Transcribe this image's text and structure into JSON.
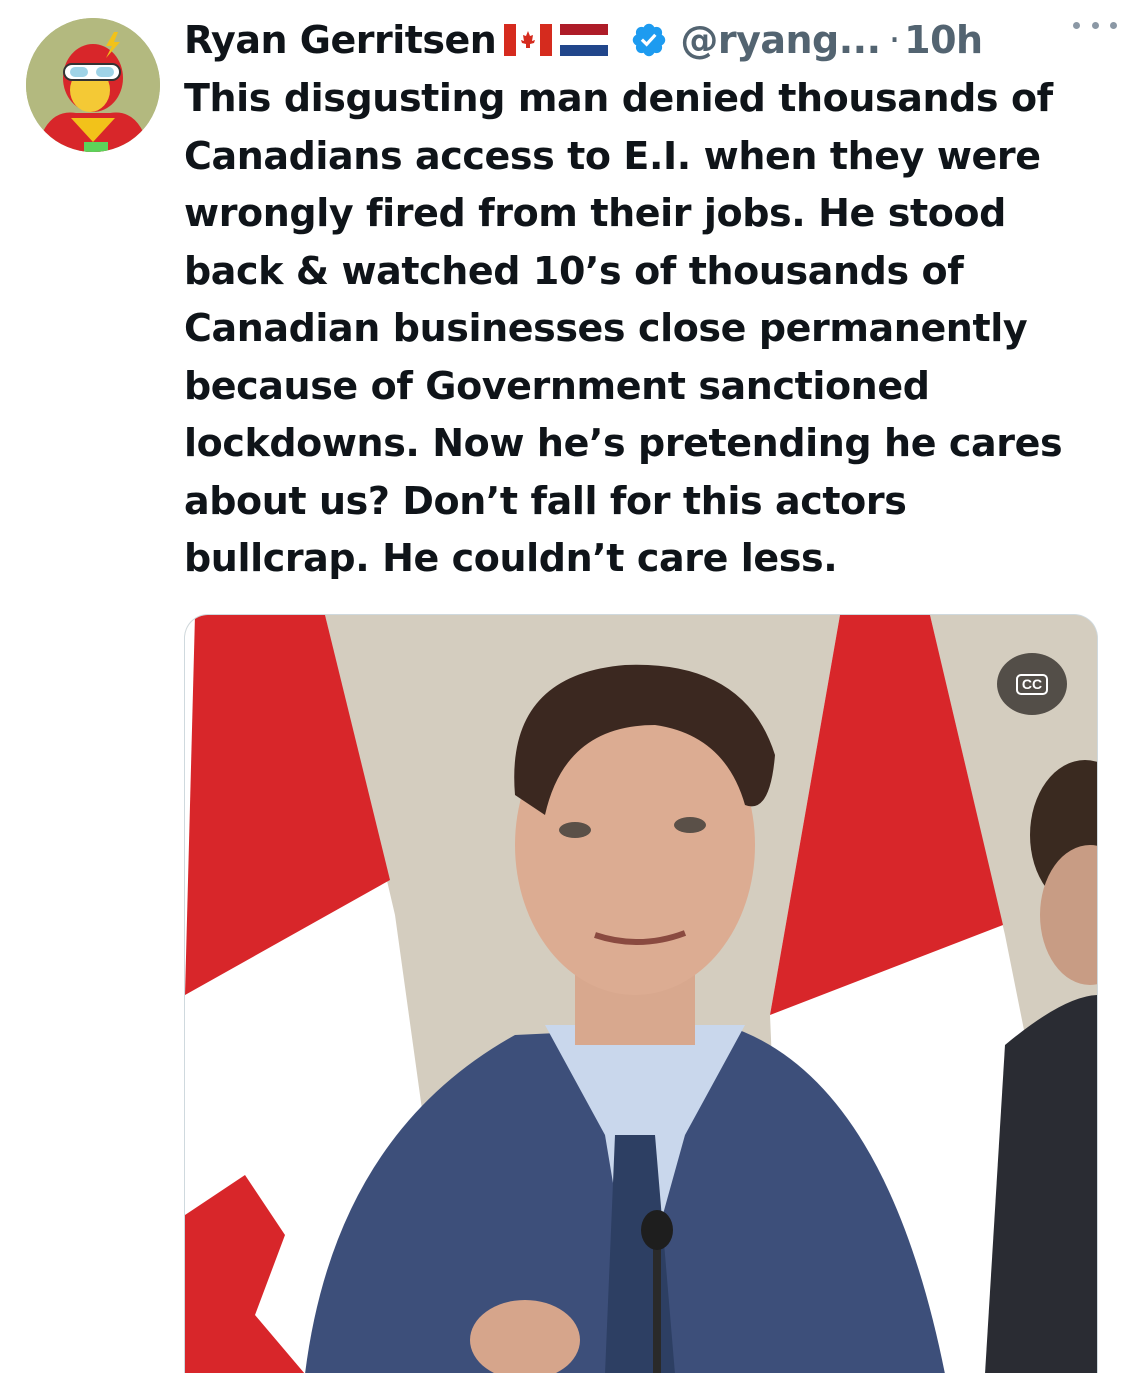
{
  "author": {
    "display_name": "Ryan Gerritsen",
    "flags": [
      "canada-flag",
      "netherlands-flag"
    ],
    "verified_icon": "verified-badge-icon",
    "handle": "@ryang...",
    "separator": "·",
    "timestamp": "10h"
  },
  "more_icon": "more-dots-icon",
  "tweet": {
    "text": "This disgusting man denied thousands of Canadians access to E.I. when they were wrongly fired from their jobs. He stood back & watched 10’s of thousands of Canadian businesses close permanently because of Government sanctioned lockdowns. Now he’s pretending he cares about us? Don’t fall for this actors bullcrap. He couldn’t care less."
  },
  "media": {
    "type": "video",
    "cc_label": "CC"
  },
  "colors": {
    "text": "#0f1419",
    "secondary": "#536471",
    "verified": "#1d9bf0",
    "flag_red": "#d52b1e"
  }
}
